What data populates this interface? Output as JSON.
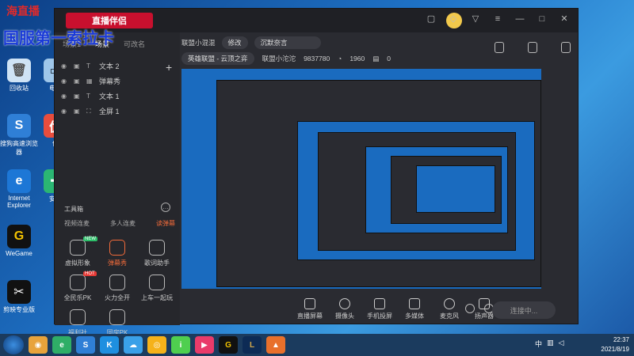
{
  "overlay": {
    "top_text": "海直播",
    "main_text": "国服第一索拉卡"
  },
  "app": {
    "logo": "直播伴侣",
    "sidebar_tabs": [
      "场景1",
      "场景",
      "可改名"
    ],
    "layers": [
      {
        "label": "文本 2",
        "type": "T"
      },
      {
        "label": "弹幕秀",
        "type": "▦"
      },
      {
        "label": "文本 1",
        "type": "T"
      },
      {
        "label": "全屏 1",
        "type": "⛶"
      }
    ],
    "tools_title": "工具箱",
    "tools_tabs": [
      "视频连麦",
      "多人连麦",
      "读弹幕"
    ],
    "tools": [
      {
        "label": "虚拟形象",
        "badge": "NEW"
      },
      {
        "label": "弹幕秀",
        "badge": ""
      },
      {
        "label": "歌词助手",
        "badge": ""
      },
      {
        "label": "全民乐PK",
        "badge": "HOT"
      },
      {
        "label": "火力全开",
        "badge": ""
      },
      {
        "label": "上车一起玩",
        "badge": ""
      },
      {
        "label": "福利社",
        "badge": ""
      },
      {
        "label": "同房PK",
        "badge": ""
      }
    ],
    "info": {
      "title": "联盟小混混",
      "modify": "修改",
      "notice": "沉默奈言",
      "category": "英雄联盟 - 云顶之弈",
      "name": "联盟小沱沱",
      "id": "9837780",
      "fans": "1960",
      "gifts": "0"
    },
    "bottom_buttons": [
      "直播屏幕",
      "摄像头",
      "手机投屏",
      "多媒体",
      "麦克风",
      "扬声器"
    ],
    "connect": "连接中..."
  },
  "desktop_icons": [
    "回收站",
    "电脑",
    "搜狗高速浏览器",
    "优",
    "Internet Explorer",
    "安全",
    "WeGame",
    "剪映专业版"
  ],
  "taskbar": {
    "time": "22:37",
    "date": "2021/8/19"
  }
}
